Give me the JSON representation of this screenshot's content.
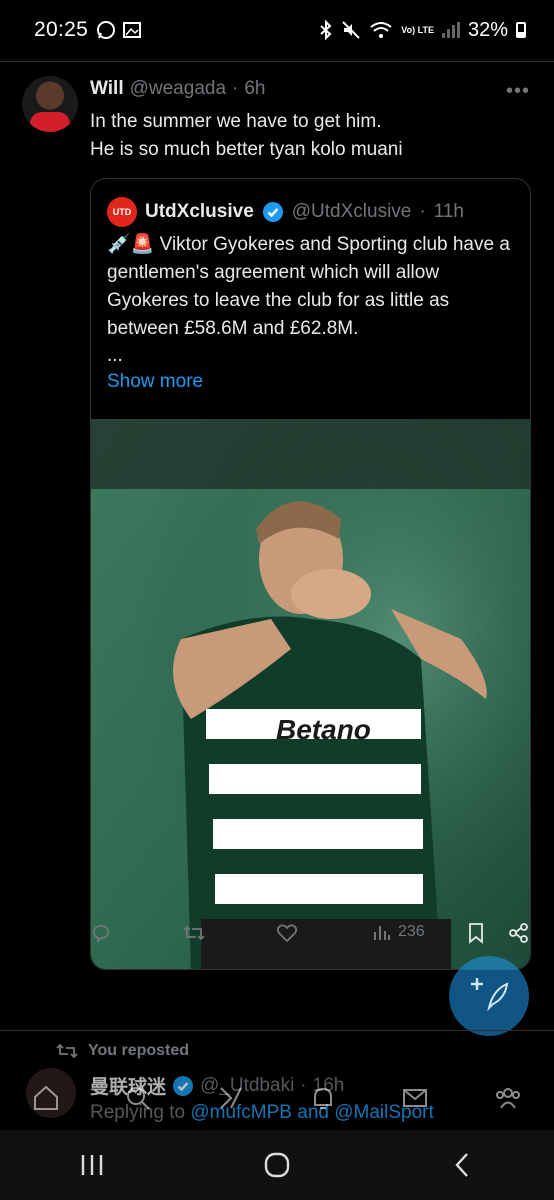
{
  "status_bar": {
    "time": "20:25",
    "lte_label": "Vo) LTE",
    "battery": "32%"
  },
  "tweet": {
    "name": "Will",
    "handle": "@weagada",
    "separator": "·",
    "time": "6h",
    "more_label": "•••",
    "text_line1": "In the summer we have to get him.",
    "text_line2": "He is so much better tyan kolo muani"
  },
  "quote": {
    "logo_text": "UTD",
    "name": "UtdXclusive",
    "handle": "@UtdXclusive",
    "separator": "·",
    "time": "11h",
    "emoji": "💉🚨",
    "text": "Viktor Gyokeres and Sporting club have a gentlemen's agreement which will allow Gyokeres to leave the club for as little as between £58.6M and £62.8M.",
    "ellipsis": "...",
    "show_more": "Show more",
    "image_jersey_text": "Betano"
  },
  "actions": {
    "views": "236"
  },
  "reposted": {
    "label": "You reposted"
  },
  "tweet2": {
    "name": "曼联球迷",
    "handle": "@_Utdbaki",
    "separator": "·",
    "time": "16h",
    "replying_prefix": "Replying to",
    "mention1": "@mufcMPB",
    "and": "and",
    "mention2": "@MailSport"
  },
  "colors": {
    "accent": "#1d9bf0",
    "background": "#000000",
    "muted": "#71767b"
  }
}
